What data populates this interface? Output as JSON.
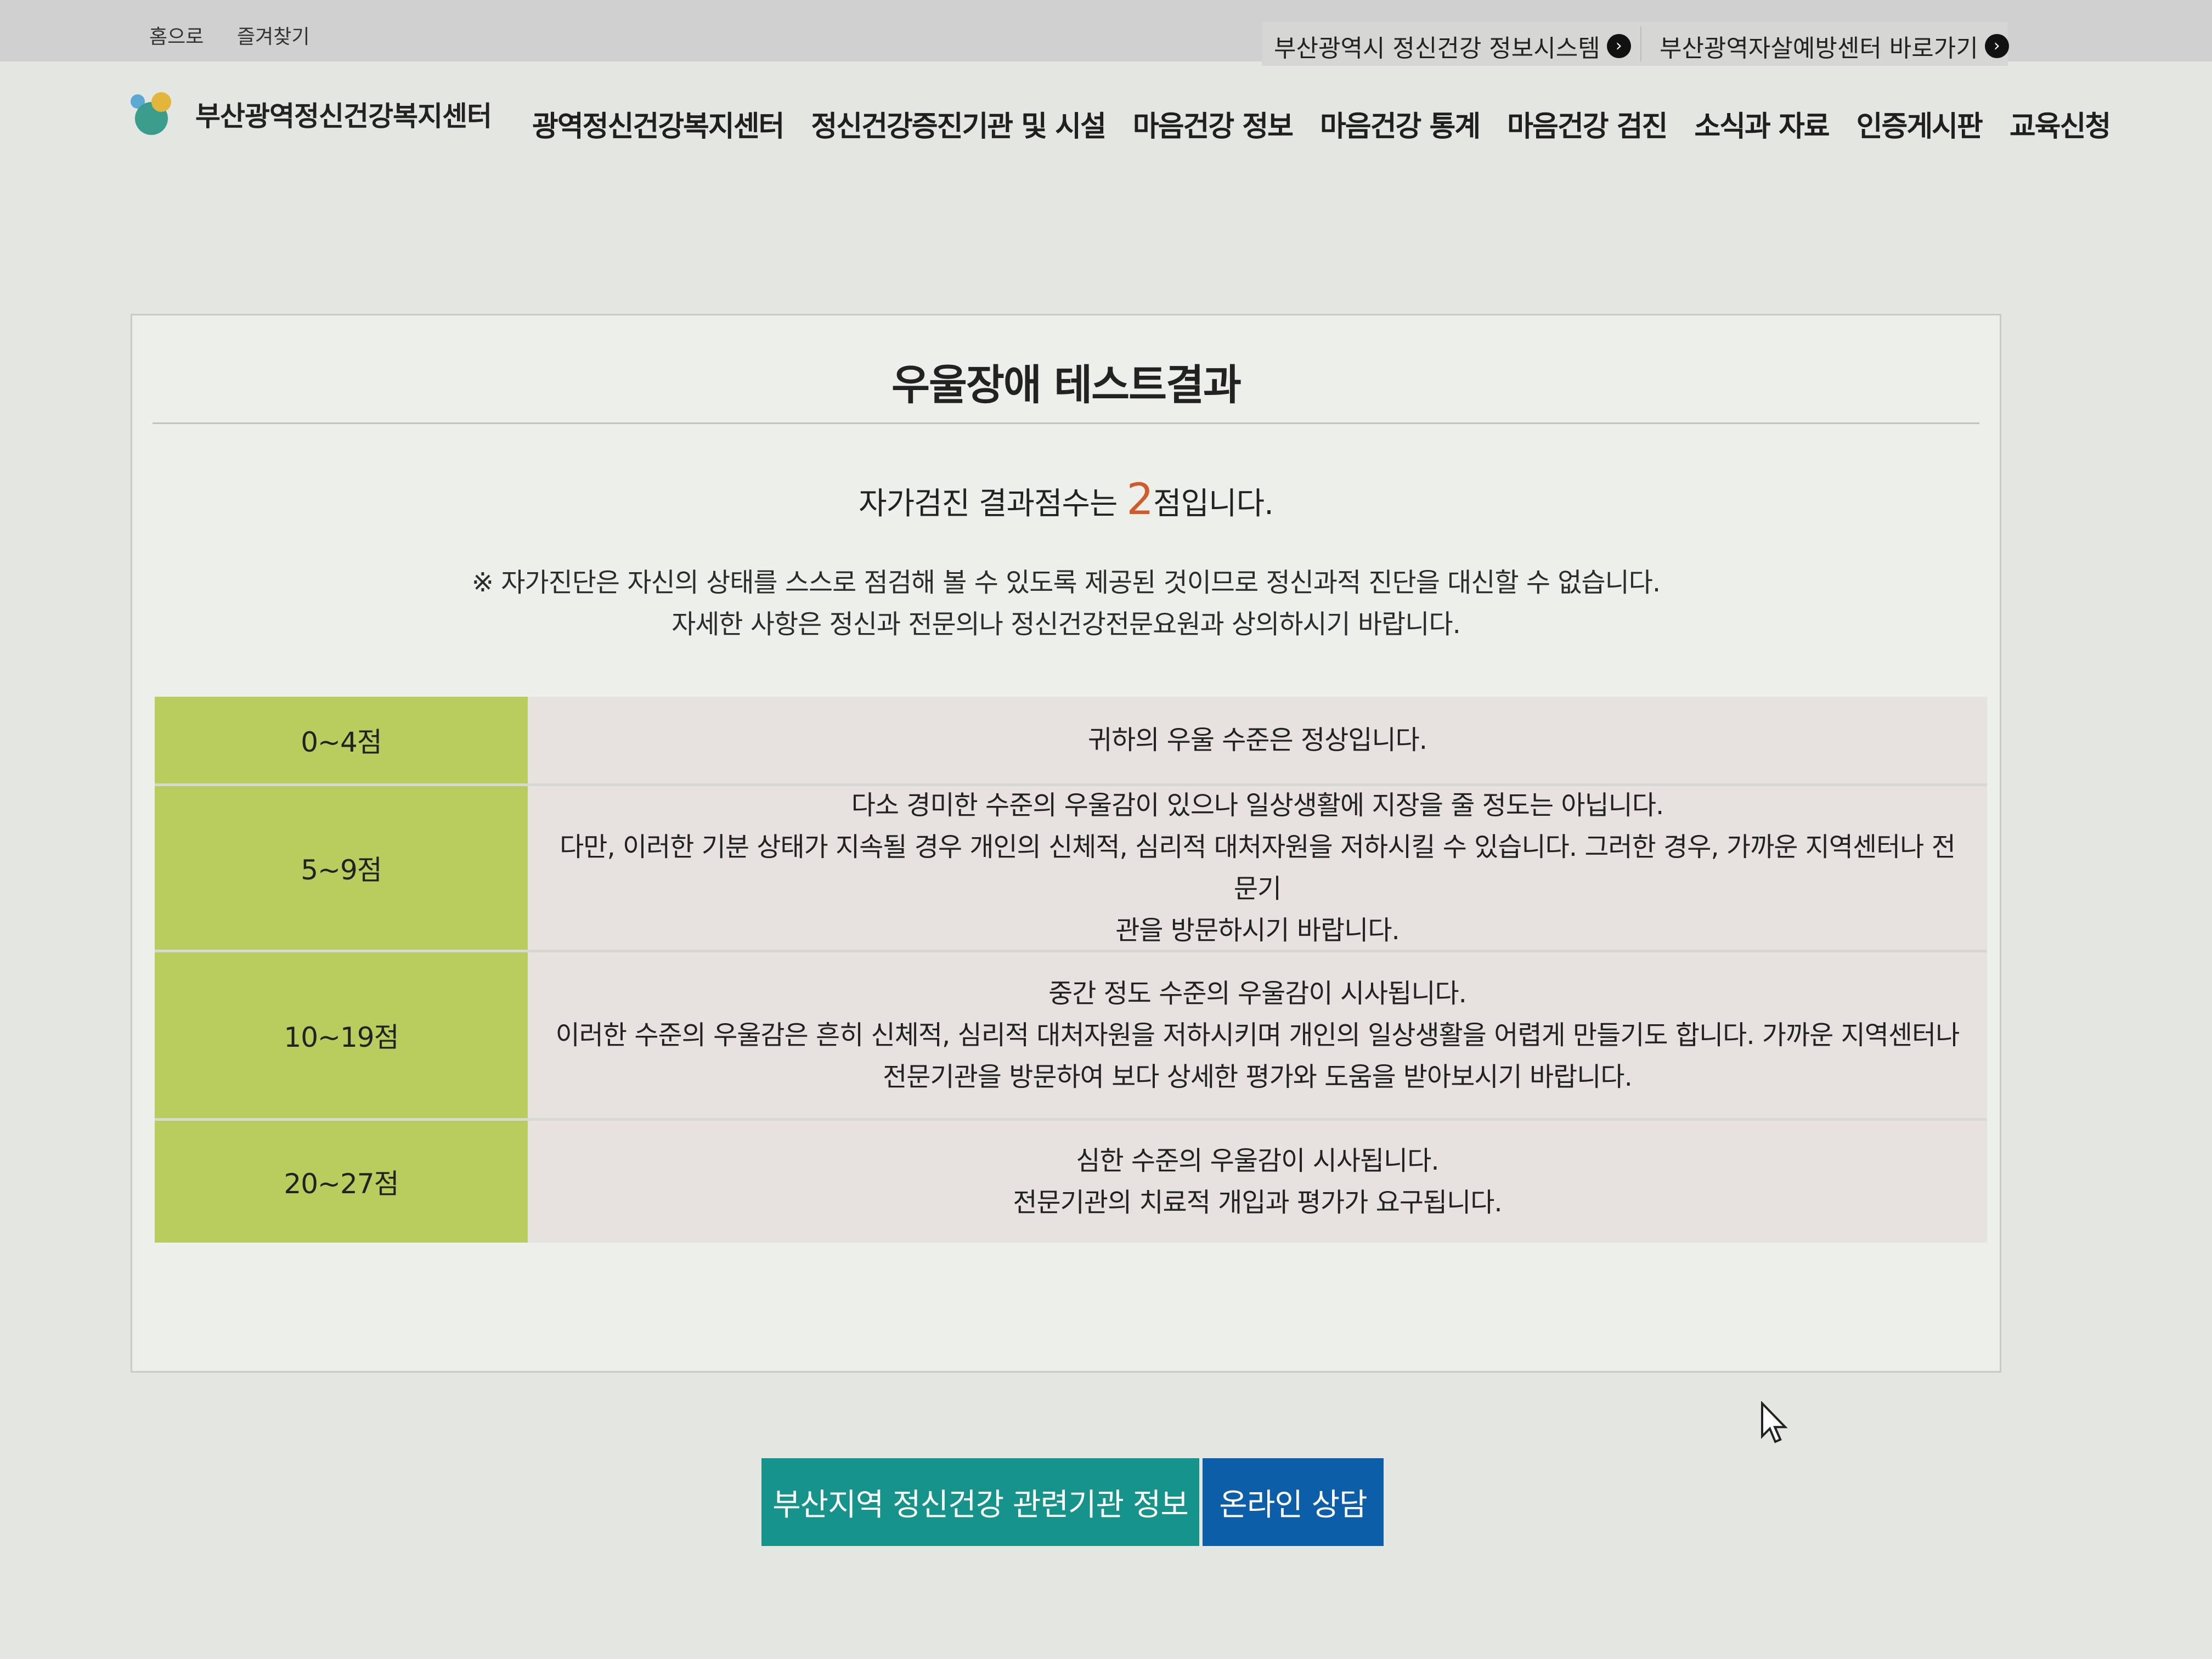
{
  "top_bar": {
    "home_link": "홈으로",
    "favorites_link": "즐겨찾기",
    "external_links": [
      {
        "label": "부산광역시 정신건강 정보시스템"
      },
      {
        "label": "부산광역자살예방센터 바로가기"
      }
    ]
  },
  "header": {
    "site_name": "부산광역정신건강복지센터",
    "nav": [
      "광역정신건강복지센터",
      "정신건강증진기관 및 시설",
      "마음건강 정보",
      "마음건강 통계",
      "마음건강 검진",
      "소식과 자료",
      "인증게시판",
      "교육신청"
    ]
  },
  "result": {
    "title": "우울장애 테스트결과",
    "score_prefix": "자가검진 결과점수는 ",
    "score_value": "2",
    "score_suffix": "점입니다.",
    "note_line1": "※ 자가진단은 자신의 상태를 스스로 점검해 볼 수 있도록 제공된 것이므로 정신과적 진단을 대신할 수 없습니다.",
    "note_line2": "자세한 사항은 정신과 전문의나 정신건강전문요원과 상의하시기 바랍니다."
  },
  "score_table": [
    {
      "range": "0~4점",
      "lines": [
        "귀하의 우울 수준은 정상입니다."
      ]
    },
    {
      "range": "5~9점",
      "lines": [
        "다소 경미한 수준의 우울감이 있으나 일상생활에 지장을 줄 정도는 아닙니다.",
        "다만, 이러한 기분 상태가 지속될 경우 개인의 신체적, 심리적 대처자원을 저하시킬 수 있습니다. 그러한 경우, 가까운 지역센터나 전문기",
        "관을 방문하시기 바랍니다."
      ]
    },
    {
      "range": "10~19점",
      "lines": [
        "중간 정도 수준의 우울감이 시사됩니다.",
        "이러한 수준의 우울감은 흔히 신체적, 심리적 대처자원을 저하시키며 개인의 일상생활을 어렵게 만들기도 합니다. 가까운 지역센터나",
        "전문기관을 방문하여 보다 상세한 평가와 도움을 받아보시기 바랍니다."
      ]
    },
    {
      "range": "20~27점",
      "lines": [
        "심한 수준의 우울감이 시사됩니다.",
        "전문기관의 치료적 개입과 평가가 요구됩니다."
      ]
    }
  ],
  "buttons": {
    "institutions": "부산지역 정신건강 관련기관 정보",
    "online_counsel": "온라인 상담"
  },
  "colors": {
    "range_cell": "#b9cc5e",
    "desc_cell": "#e7e2df",
    "score_highlight": "#d05a2c",
    "button_teal": "#16938a",
    "button_blue": "#0d5ea8"
  },
  "icons": {
    "external_link": "arrow-circle-right-icon",
    "cursor": "mouse-pointer-icon"
  }
}
